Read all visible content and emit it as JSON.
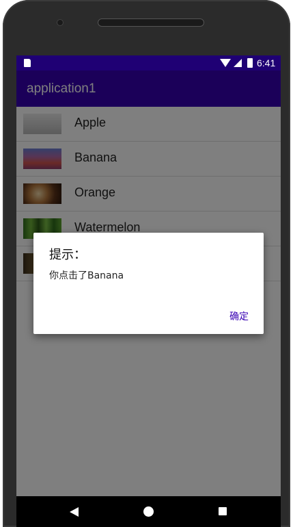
{
  "status_bar": {
    "time": "6:41"
  },
  "app_bar": {
    "title": "application1",
    "color": "#3700b3"
  },
  "fruits": [
    {
      "name": "Apple"
    },
    {
      "name": "Banana"
    },
    {
      "name": "Orange"
    },
    {
      "name": "Watermelon"
    },
    {
      "name": ""
    }
  ],
  "dialog": {
    "title": "提示：",
    "message": "你点击了Banana",
    "ok_button": "确定"
  },
  "icons": [
    "sd-card-icon",
    "wifi-icon",
    "signal-icon",
    "battery-icon",
    "back-icon",
    "home-icon",
    "recents-icon"
  ]
}
